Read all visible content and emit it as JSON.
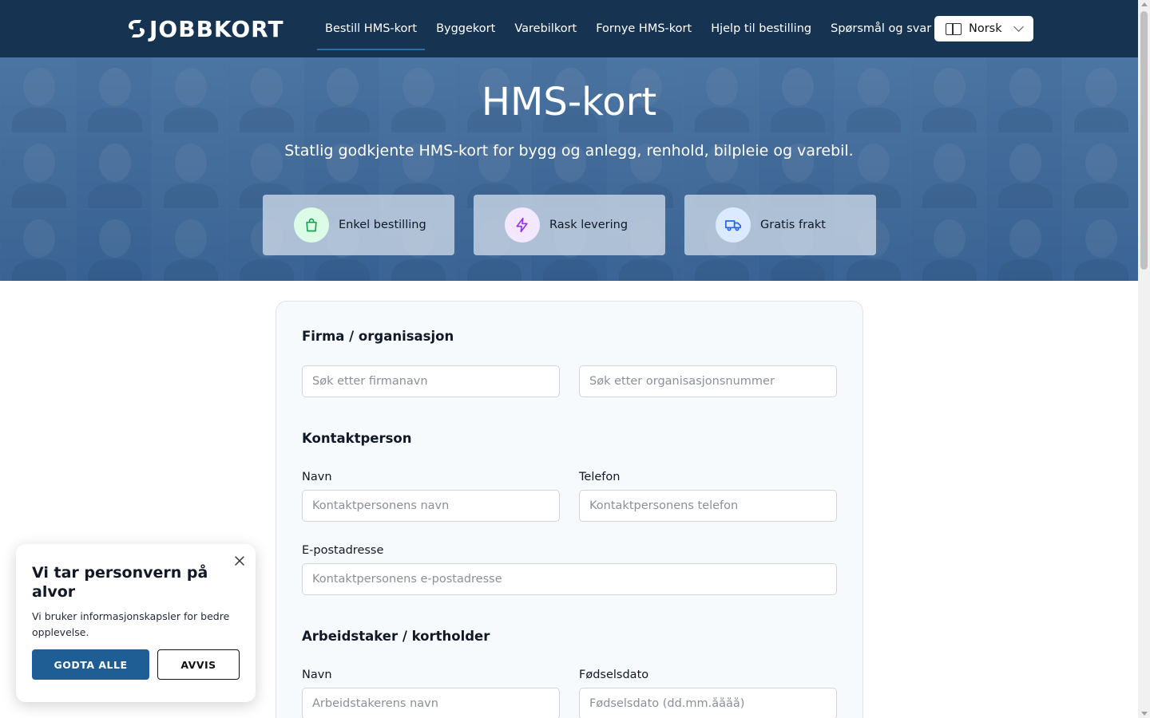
{
  "header": {
    "logo_text": "JOBBKORT",
    "nav": [
      {
        "label": "Bestill HMS-kort",
        "active": true
      },
      {
        "label": "Byggekort"
      },
      {
        "label": "Varebilkort"
      },
      {
        "label": "Fornye HMS-kort"
      },
      {
        "label": "Hjelp til bestilling"
      },
      {
        "label": "Spørsmål og svar"
      }
    ],
    "language": "Norsk"
  },
  "hero": {
    "title": "HMS-kort",
    "subtitle": "Statlig godkjente HMS-kort for bygg og anlegg, renhold, bilpleie og varebil.",
    "features": [
      {
        "label": "Enkel bestilling",
        "icon": "shopping-bag-icon",
        "color": "#16a34a",
        "bg": "#dcfce7"
      },
      {
        "label": "Rask levering",
        "icon": "lightning-icon",
        "color": "#9333ea",
        "bg": "#f3e8ff"
      },
      {
        "label": "Gratis frakt",
        "icon": "truck-icon",
        "color": "#2563eb",
        "bg": "#dbeafe"
      }
    ]
  },
  "form": {
    "company": {
      "title": "Firma / organisasjon",
      "name_placeholder": "Søk etter firmanavn",
      "orgnr_placeholder": "Søk etter organisasjonsnummer"
    },
    "contact": {
      "title": "Kontaktperson",
      "name_label": "Navn",
      "name_placeholder": "Kontaktpersonens navn",
      "phone_label": "Telefon",
      "phone_placeholder": "Kontaktpersonens telefon",
      "email_label": "E-postadresse",
      "email_placeholder": "Kontaktpersonens e-postadresse"
    },
    "worker": {
      "title": "Arbeidstaker / kortholder",
      "name_label": "Navn",
      "name_placeholder": "Arbeidstakerens navn",
      "dob_label": "Fødselsdato",
      "dob_placeholder": "Fødselsdato (dd.mm.åååå)"
    }
  },
  "cookie": {
    "title": "Vi tar personvern på alvor",
    "text": "Vi bruker informasjonskapsler for bedre opplevelse.",
    "accept_label": "GODTA ALLE",
    "decline_label": "AVVIS"
  },
  "colors": {
    "header_bg": "#163452",
    "accent": "#1f5d95"
  }
}
